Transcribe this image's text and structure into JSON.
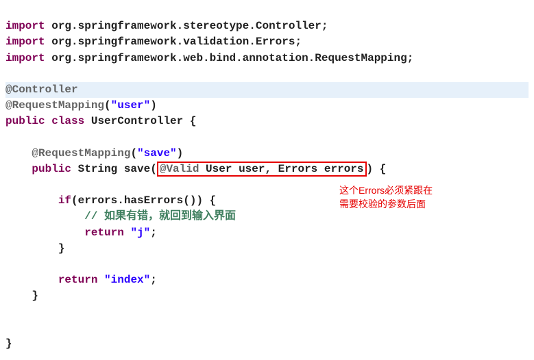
{
  "imports": {
    "line1_kw": "import",
    "line1_pkg": " org.springframework.stereotype.Controller;",
    "line2_kw": "import",
    "line2_pkg": " org.springframework.validation.Errors;",
    "line3_kw": "import",
    "line3_pkg": " org.springframework.web.bind.annotation.RequestMapping;"
  },
  "class_decl": {
    "anno1": "@Controller",
    "anno2_name": "@RequestMapping",
    "anno2_open": "(",
    "anno2_str": "\"user\"",
    "anno2_close": ")",
    "pub": "public",
    "cls": "class",
    "name": " UserController {"
  },
  "method": {
    "anno_name": "@RequestMapping",
    "anno_open": "(",
    "anno_str": "\"save\"",
    "anno_close": ")",
    "pub": "public",
    "ret": " String save(",
    "box_anno": "@Valid",
    "box_text": " User user, Errors errors",
    "after_box": ") {"
  },
  "body": {
    "if_kw": "if",
    "if_cond": "(errors.hasErrors()) {",
    "comment": "// 如果有错，就回到输入界面",
    "return1_kw": "return",
    "return1_val": "\"j\"",
    "semi": ";",
    "close_if": "}",
    "return2_kw": "return",
    "return2_val": "\"index\"",
    "close_method": "}",
    "close_class": "}"
  },
  "note": {
    "line1": "这个Errors必须紧跟在",
    "line2": "需要校验的参数后面"
  }
}
